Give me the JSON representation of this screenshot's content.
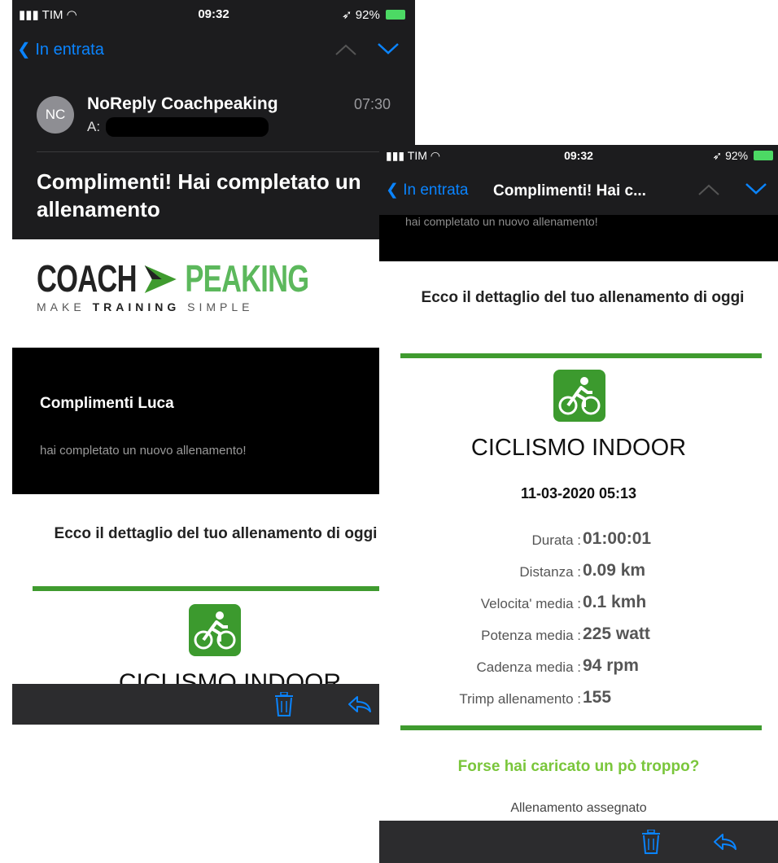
{
  "left_screen": {
    "status": {
      "carrier": "TIM",
      "time": "09:32",
      "battery": "92%"
    },
    "nav": {
      "back_label": "In entrata"
    },
    "email": {
      "avatar_initials": "NC",
      "sender": "NoReply Coachpeaking",
      "recipient_prefix": "A:",
      "time": "07:30",
      "subject": "Complimenti! Hai completato un allenamento"
    },
    "logo": {
      "part1": "COACH",
      "part2": "PEAKING",
      "tag_a": "MAKE",
      "tag_b": "TRAINING",
      "tag_c": "SIMPLE"
    },
    "greeting": {
      "title": "Complimenti Luca",
      "subtitle": "hai completato un nuovo allenamento!"
    },
    "intro": "Ecco il dettaglio del tuo allenamento di oggi",
    "activity_title": "CICLISMO INDOOR"
  },
  "right_screen": {
    "status": {
      "carrier": "TIM",
      "time": "09:32",
      "battery": "92%"
    },
    "nav": {
      "back_label": "In entrata",
      "title": "Complimenti! Hai c..."
    },
    "peek_text": "hai completato un nuovo allenamento!",
    "intro": "Ecco il dettaglio del tuo allenamento di oggi",
    "activity_title": "CICLISMO INDOOR",
    "date": "11-03-2020 05:13",
    "stats": [
      {
        "label": "Durata :",
        "value": "01:00:01"
      },
      {
        "label": "Distanza :",
        "value": "0.09 km"
      },
      {
        "label": "Velocita' media :",
        "value": "0.1 kmh"
      },
      {
        "label": "Potenza media :",
        "value": "225 watt"
      },
      {
        "label": "Cadenza media :",
        "value": "94 rpm"
      },
      {
        "label": "Trimp allenamento :",
        "value": "155"
      }
    ],
    "warning": "Forse hai caricato un pò troppo?",
    "assigned": "Allenamento assegnato"
  },
  "colors": {
    "accent_green": "#3f9b2f",
    "ios_blue": "#0a84ff",
    "warning_green": "#7ac63b"
  },
  "icons": [
    "back-chevron-icon",
    "chevron-up-icon",
    "chevron-down-icon",
    "cycling-icon",
    "trash-icon",
    "reply-icon",
    "wifi-icon",
    "signal-icon",
    "battery-icon",
    "location-arrow-icon"
  ]
}
